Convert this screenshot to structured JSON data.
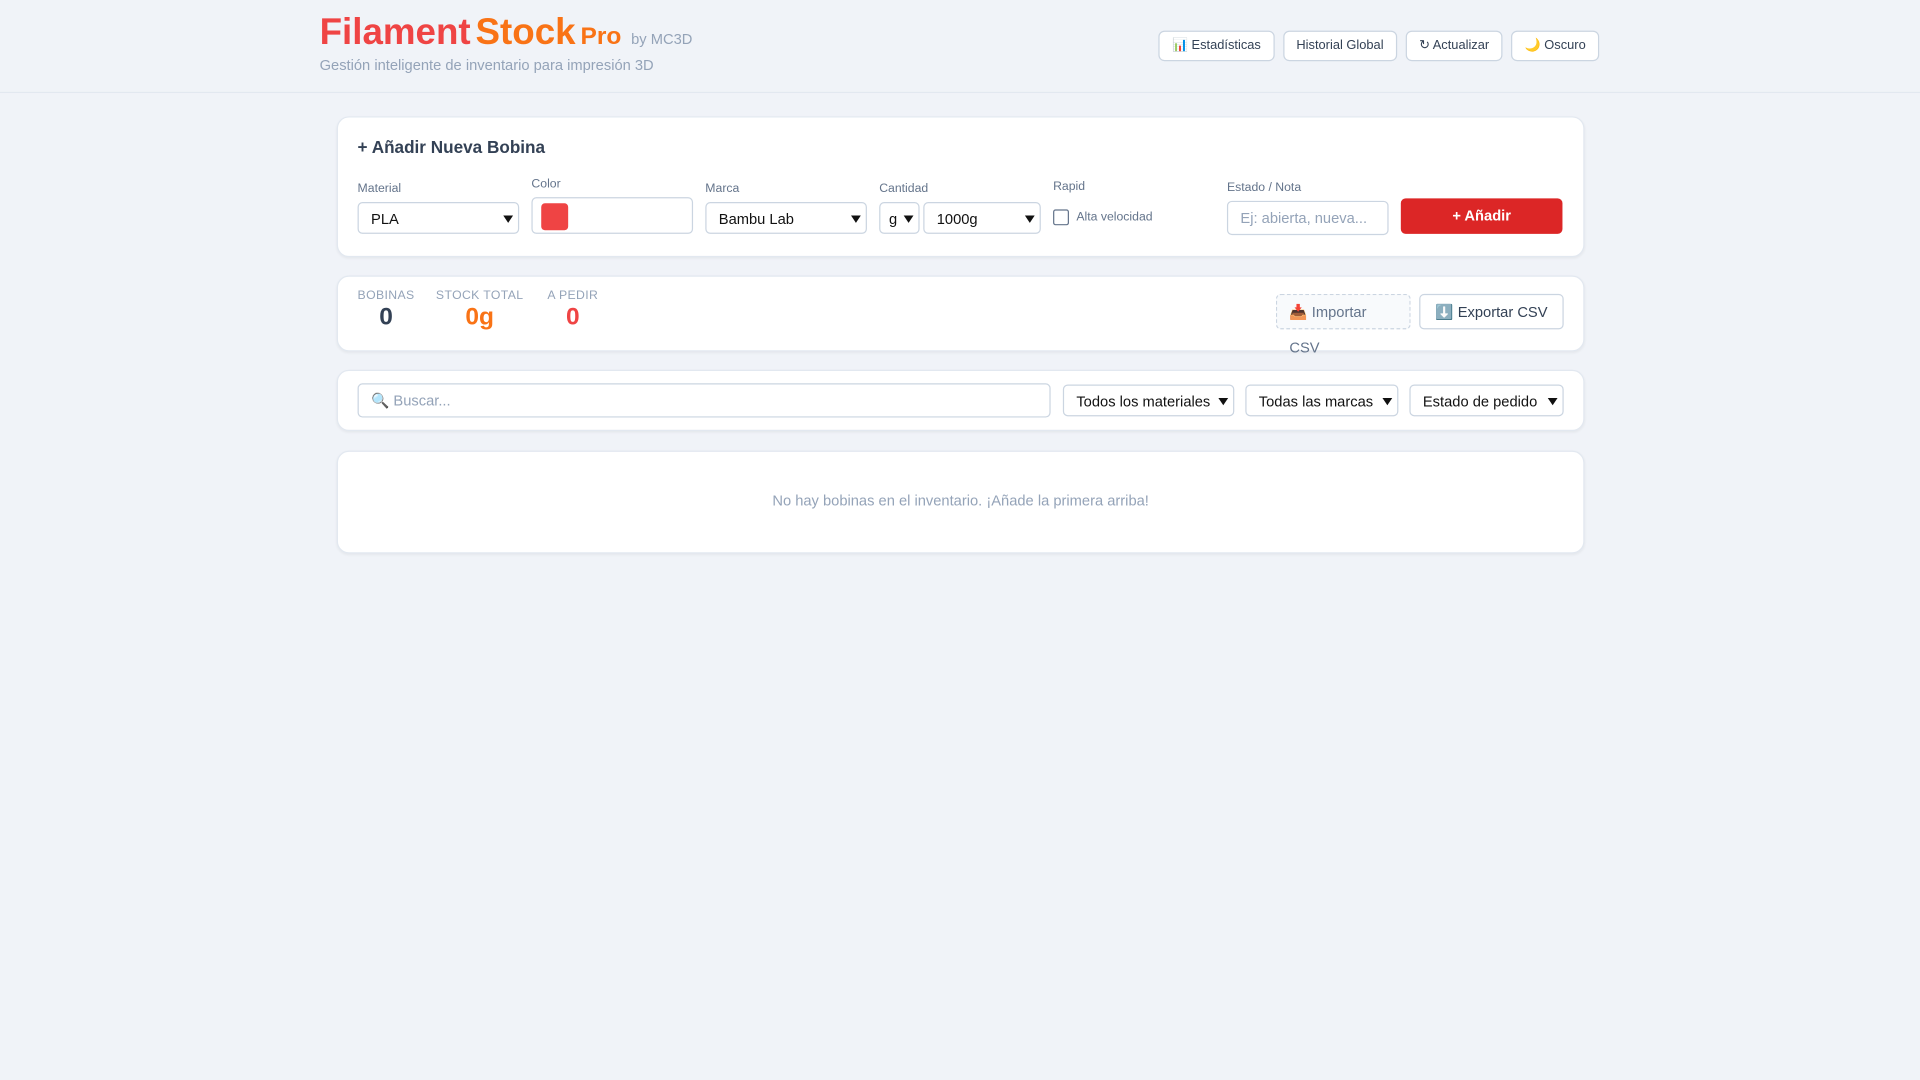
{
  "header": {
    "brand_part1": "Filament",
    "brand_part2": "Stock",
    "brand_part3": "Pro",
    "brand_by": "by MC3D",
    "subtitle": "Gestión inteligente de inventario para impresión 3D",
    "buttons": [
      {
        "label": "📊 Estadísticas"
      },
      {
        "label": "Historial Global"
      },
      {
        "label": "↻ Actualizar"
      },
      {
        "label": "🌙 Oscuro"
      }
    ]
  },
  "add_form": {
    "title": "+ Añadir Nueva Bobina",
    "material_label": "Material",
    "material_value": "PLA",
    "color_label": "Color",
    "color_value": "#ef4444",
    "brand_label": "Marca",
    "brand_value": "Bambu Lab",
    "quantity_label": "Cantidad",
    "unit_value": "g",
    "quantity_value": "1000g",
    "rapid_label": "Rapid",
    "rapid_checkbox_label": "Alta velocidad",
    "rapid_checked": false,
    "status_label": "Estado / Nota",
    "status_placeholder": "Ej: abierta, nueva...",
    "add_button": "+ Añadir"
  },
  "stats": {
    "spools_label": "BOBINAS",
    "spools_value": "0",
    "total_label": "STOCK TOTAL",
    "total_value": "0g",
    "order_label": "A PEDIR",
    "order_value": "0",
    "import_button": "📥 Importar CSV",
    "export_button": "⬇️ Exportar CSV"
  },
  "filters": {
    "search_placeholder": "🔍 Buscar...",
    "material_filter": "Todos los materiales",
    "brand_filter": "Todas las marcas",
    "order_filter": "Estado de pedido"
  },
  "inventory": {
    "empty_message": "No hay bobinas en el inventario. ¡Añade la primera arriba!"
  }
}
